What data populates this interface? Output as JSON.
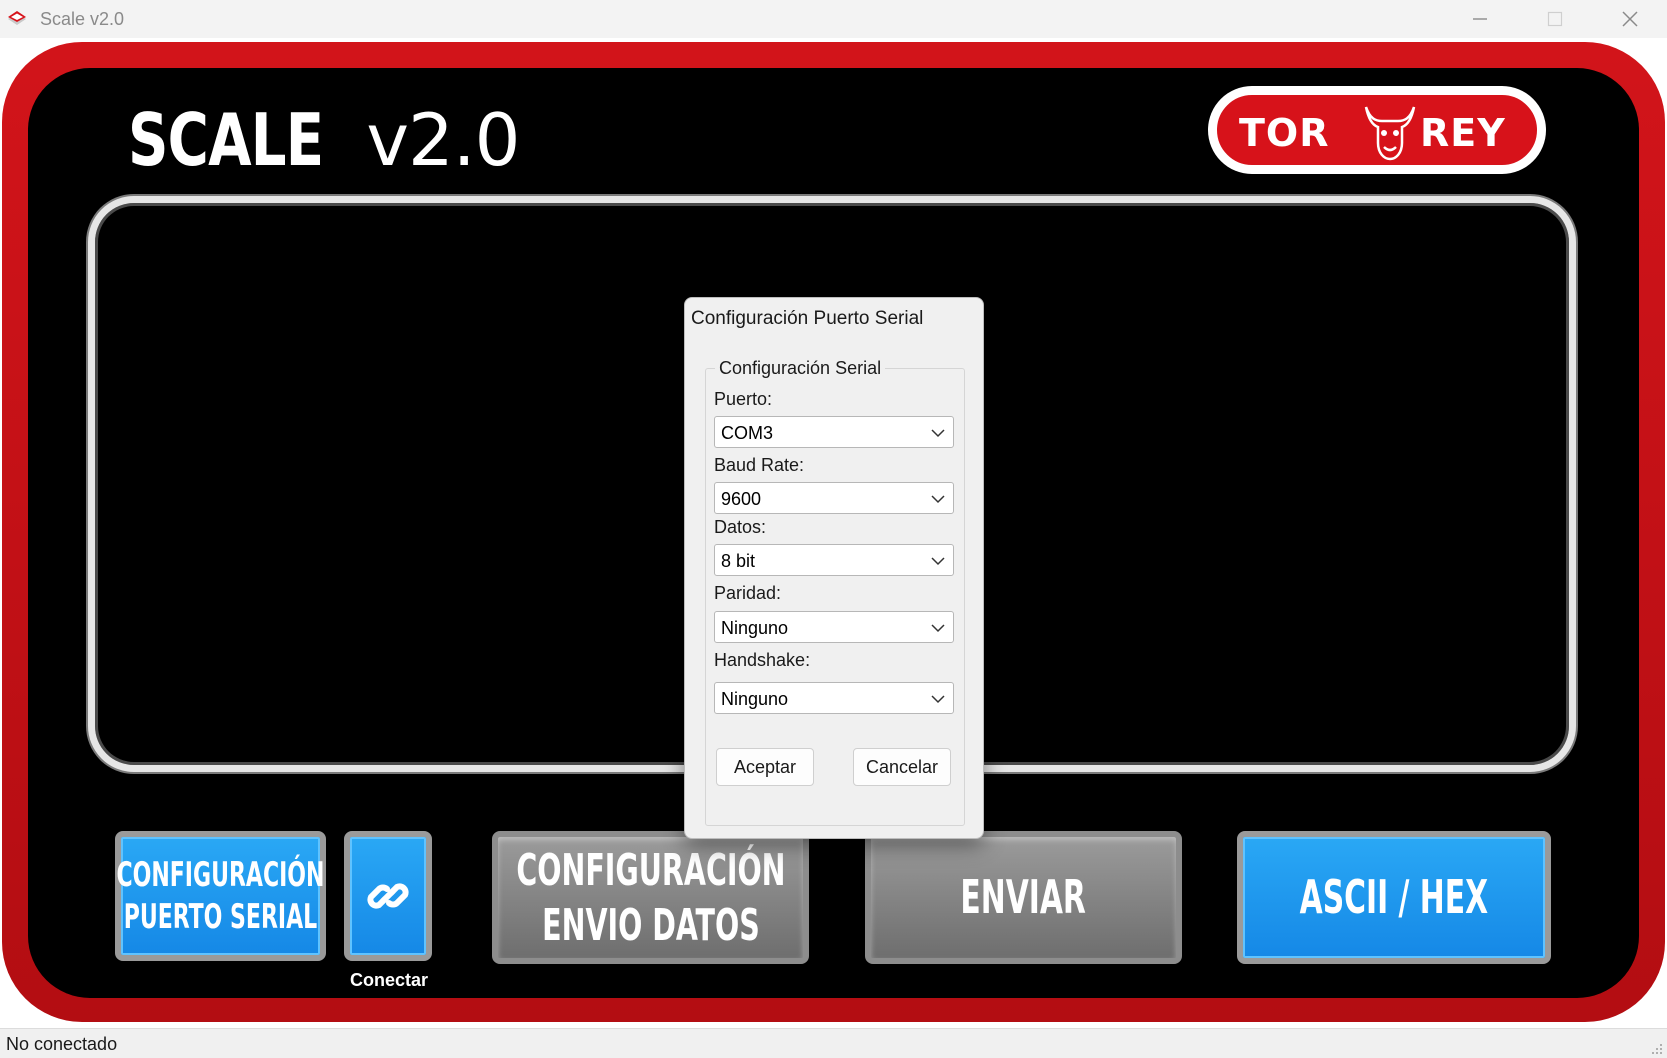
{
  "window": {
    "title": "Scale v2.0",
    "app_icon": "scale-app-icon",
    "controls": [
      "minimize-icon",
      "maximize-icon",
      "close-icon"
    ]
  },
  "header": {
    "title_bold": "SCALE",
    "title_version": "v2.0",
    "brand_left": "TOR",
    "brand_right": "REY",
    "brand_icon": "bull-head-icon"
  },
  "dialog": {
    "title": "Configuración Puerto Serial",
    "group_label": "Configuración Serial",
    "fields": {
      "puerto": {
        "label": "Puerto:",
        "value": "COM3"
      },
      "baud": {
        "label": "Baud Rate:",
        "value": "9600"
      },
      "datos": {
        "label": "Datos:",
        "value": "8 bit"
      },
      "paridad": {
        "label": "Paridad:",
        "value": "Ninguno"
      },
      "handshake": {
        "label": "Handshake:",
        "value": "Ninguno"
      }
    },
    "ok_label": "Aceptar",
    "cancel_label": "Cancelar"
  },
  "buttons": {
    "serial_line1": "CONFIGURACIÓN",
    "serial_line2": "PUERTO SERIAL",
    "connect_icon": "link-icon",
    "connect_label": "Conectar",
    "envio_line1": "CONFIGURACIÓN",
    "envio_line2": "ENVIO DATOS",
    "enviar": "ENVIAR",
    "ascii_hex": "ASCII / HEX"
  },
  "status": {
    "text": "No conectado"
  },
  "colors": {
    "frame_red": "#d2141a",
    "button_blue": "#1e98ee",
    "button_gray": "#7d7d7d",
    "screen": "#000000"
  }
}
